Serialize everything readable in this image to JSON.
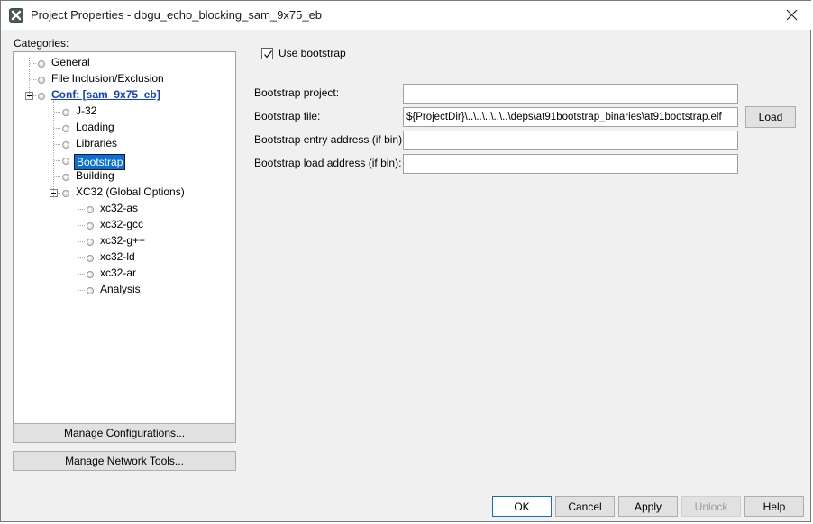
{
  "window": {
    "title": "Project Properties - dbgu_echo_blocking_sam_9x75_eb",
    "app_icon": "x-app-icon",
    "close_icon": "close-icon"
  },
  "colors": {
    "dialog_bg": "#f0f0f0",
    "selection_blue": "#0a6fd8",
    "link_blue": "#1141c4",
    "button_face": "#e1e1e1",
    "field_white": "#ffffff",
    "border_gray": "#a0a0a0",
    "disabled_text": "#9d9d9d"
  },
  "categories": {
    "label": "Categories:",
    "tree": [
      {
        "label": "General",
        "level": 0,
        "expander": "none",
        "selected": false,
        "style": "normal"
      },
      {
        "label": "File Inclusion/Exclusion",
        "level": 0,
        "expander": "none",
        "selected": false,
        "style": "normal"
      },
      {
        "label": "Conf: [sam_9x75_eb]",
        "level": 0,
        "expander": "collapse",
        "selected": false,
        "style": "link"
      },
      {
        "label": "J-32",
        "level": 1,
        "expander": "none",
        "selected": false,
        "style": "normal"
      },
      {
        "label": "Loading",
        "level": 1,
        "expander": "none",
        "selected": false,
        "style": "normal"
      },
      {
        "label": "Libraries",
        "level": 1,
        "expander": "none",
        "selected": false,
        "style": "normal"
      },
      {
        "label": "Bootstrap",
        "level": 1,
        "expander": "none",
        "selected": true,
        "style": "normal"
      },
      {
        "label": "Building",
        "level": 1,
        "expander": "none",
        "selected": false,
        "style": "normal"
      },
      {
        "label": "XC32 (Global Options)",
        "level": 1,
        "expander": "collapse",
        "selected": false,
        "style": "normal"
      },
      {
        "label": "xc32-as",
        "level": 2,
        "expander": "none",
        "selected": false,
        "style": "normal"
      },
      {
        "label": "xc32-gcc",
        "level": 2,
        "expander": "none",
        "selected": false,
        "style": "normal"
      },
      {
        "label": "xc32-g++",
        "level": 2,
        "expander": "none",
        "selected": false,
        "style": "normal"
      },
      {
        "label": "xc32-ld",
        "level": 2,
        "expander": "none",
        "selected": false,
        "style": "normal"
      },
      {
        "label": "xc32-ar",
        "level": 2,
        "expander": "none",
        "selected": false,
        "style": "normal"
      },
      {
        "label": "Analysis",
        "level": 2,
        "expander": "none",
        "selected": false,
        "style": "normal"
      }
    ],
    "manage_configurations_label": "Manage Configurations...",
    "manage_network_tools_label": "Manage Network Tools..."
  },
  "panel": {
    "use_bootstrap": {
      "label": "Use bootstrap",
      "checked": true
    },
    "fields": [
      {
        "label": "Bootstrap project:",
        "value": "",
        "placeholder": ""
      },
      {
        "label": "Bootstrap file:",
        "value": "${ProjectDir}\\..\\..\\..\\..\\..\\deps\\at91bootstrap_binaries\\at91bootstrap.elf",
        "placeholder": ""
      },
      {
        "label": "Bootstrap entry address (if bin):",
        "value": "",
        "placeholder": ""
      },
      {
        "label": "Bootstrap load address (if bin):",
        "value": "",
        "placeholder": ""
      }
    ],
    "load_button_label": "Load"
  },
  "footer": {
    "buttons": [
      {
        "label": "OK",
        "state": "default-focused"
      },
      {
        "label": "Cancel",
        "state": "normal"
      },
      {
        "label": "Apply",
        "state": "normal"
      },
      {
        "label": "Unlock",
        "state": "disabled"
      },
      {
        "label": "Help",
        "state": "normal"
      }
    ]
  }
}
